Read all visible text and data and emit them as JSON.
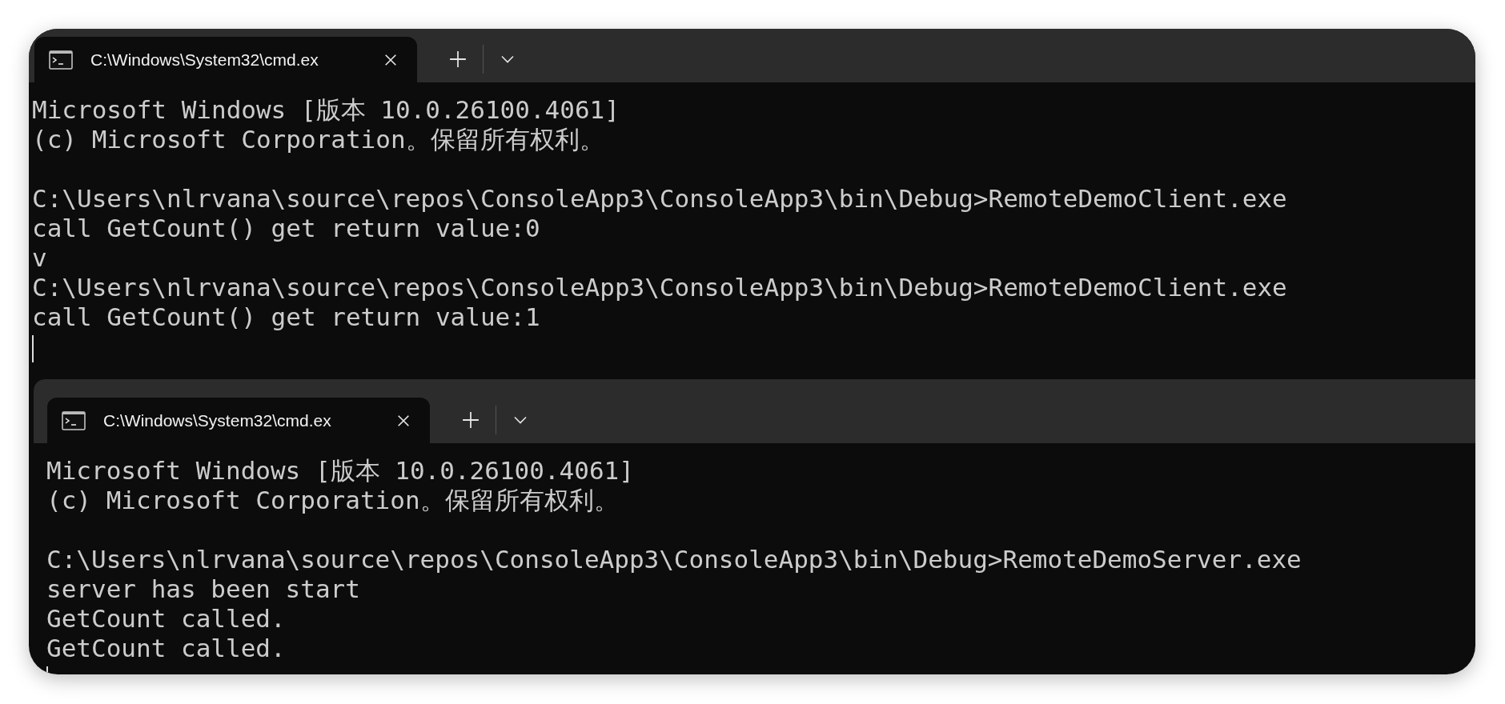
{
  "windows": [
    {
      "tab": {
        "title": "C:\\Windows\\System32\\cmd.ex",
        "selected": true
      },
      "blocks": [
        [
          "Microsoft Windows [版本 10.0.26100.4061]",
          "(c) Microsoft Corporation。保留所有权利。"
        ],
        [
          "C:\\Users\\nlrvana\\source\\repos\\ConsoleApp3\\ConsoleApp3\\bin\\Debug>RemoteDemoClient.exe",
          "call GetCount() get return value:0",
          "v",
          "C:\\Users\\nlrvana\\source\\repos\\ConsoleApp3\\ConsoleApp3\\bin\\Debug>RemoteDemoClient.exe",
          "call GetCount() get return value:1"
        ]
      ]
    },
    {
      "tab": {
        "title": "C:\\Windows\\System32\\cmd.ex",
        "selected": true
      },
      "blocks": [
        [
          "Microsoft Windows [版本 10.0.26100.4061]",
          "(c) Microsoft Corporation。保留所有权利。"
        ],
        [
          "C:\\Users\\nlrvana\\source\\repos\\ConsoleApp3\\ConsoleApp3\\bin\\Debug>RemoteDemoServer.exe",
          "server has been start",
          "GetCount called.",
          "GetCount called."
        ]
      ]
    }
  ]
}
